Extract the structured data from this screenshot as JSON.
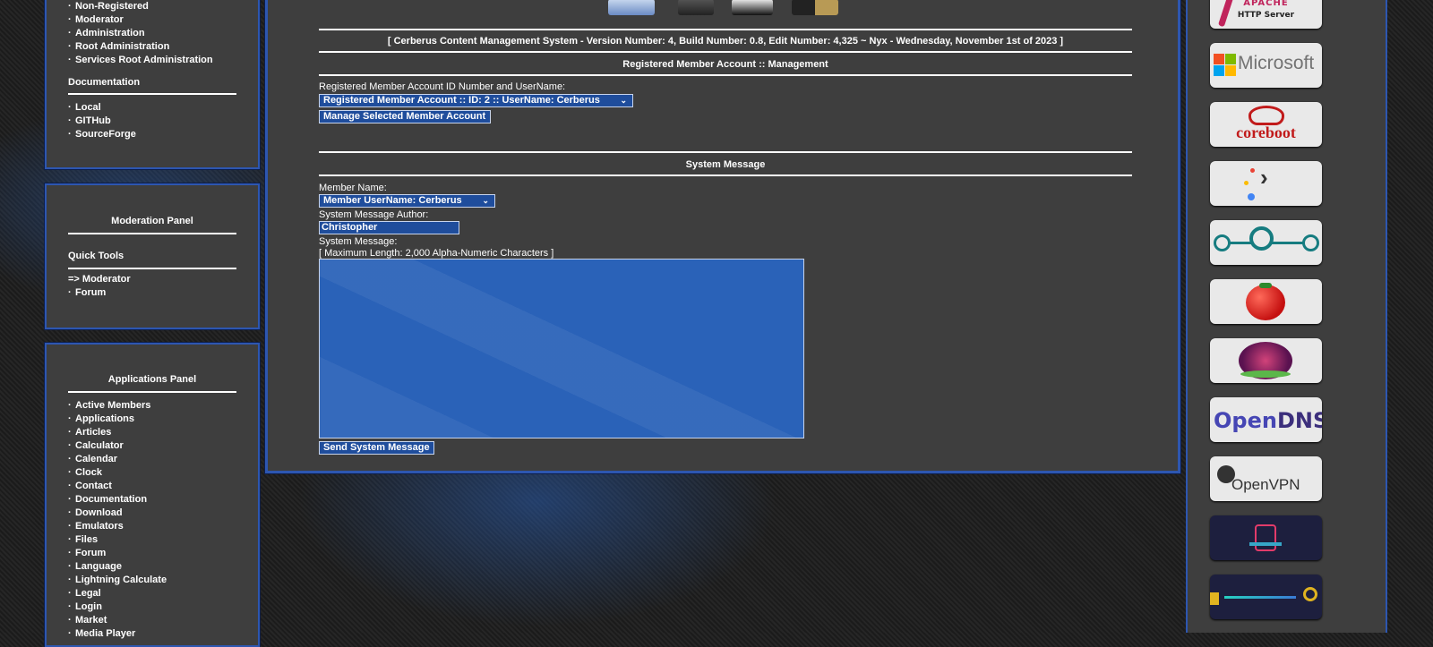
{
  "left": {
    "top_links": [
      "Non-Registered",
      "Moderator",
      "Administration",
      "Root Administration",
      "Services Root Administration"
    ],
    "documentation": {
      "title": "Documentation",
      "links": [
        "Local",
        "GITHub",
        "SourceForge"
      ]
    },
    "moderation": {
      "title": "Moderation Panel",
      "quick_tools": "Quick Tools",
      "moderator_link": "=> Moderator",
      "links": [
        "Forum"
      ]
    },
    "applications": {
      "title": "Applications Panel",
      "links": [
        "Active Members",
        "Applications",
        "Articles",
        "Calculator",
        "Calendar",
        "Clock",
        "Contact",
        "Documentation",
        "Download",
        "Emulators",
        "Files",
        "Forum",
        "Language",
        "Lightning Calculate",
        "Legal",
        "Login",
        "Market",
        "Media Player"
      ]
    }
  },
  "main": {
    "version_line": "[ Cerberus Content Management System - Version Number: 4, Build Number: 0.8, Edit Number: 4,325 ~ Nyx - Wednesday, November 1st of 2023 ]",
    "account_management": {
      "title": "Registered Member Account :: Management",
      "label": "Registered Member Account ID Number and UserName:",
      "selected": "Registered Member Account :: ID: 2 :: UserName: Cerberus",
      "button": "Manage Selected Member Account"
    },
    "system_message": {
      "title": "System Message",
      "member_label": "Member Name:",
      "member_selected": "Member UserName: Cerberus",
      "author_label": "System Message Author:",
      "author_value": "Christopher",
      "message_label": "System Message:",
      "max_length": "[ Maximum Length: 2,000 Alpha-Numeric Characters ]",
      "message_value": "",
      "send_button": "Send System Message"
    }
  },
  "right": {
    "apache_top": "APACHE",
    "apache_sub": "HTTP Server",
    "microsoft": "Microsoft",
    "coreboot": "coreboot",
    "opendns_a": "Open",
    "opendns_b": "DNS",
    "openvpn": "OpenVPN"
  },
  "colors": {
    "panel": "#3e3e3e",
    "border": "#2d56b0",
    "control": "#1f4d9c"
  }
}
